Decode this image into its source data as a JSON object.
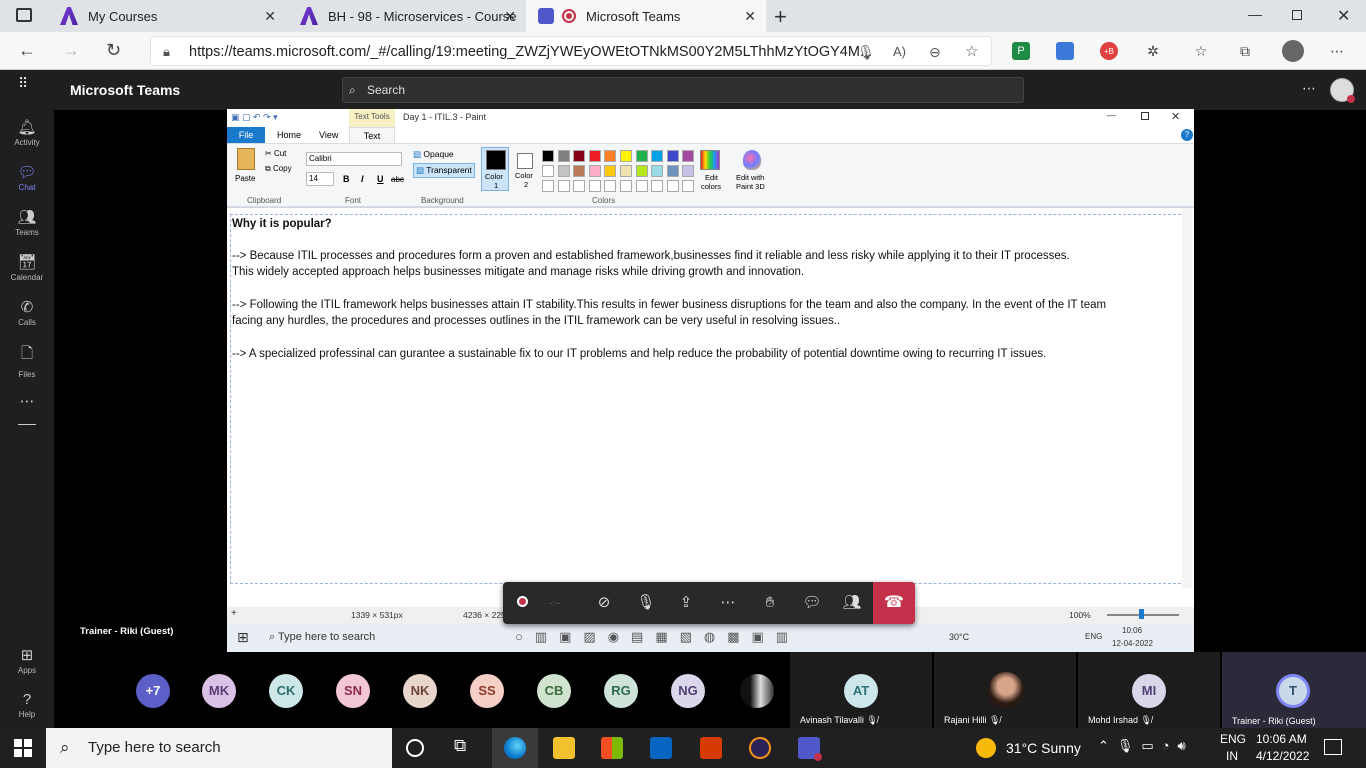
{
  "browser": {
    "tabs": [
      {
        "title": "My Courses"
      },
      {
        "title": "BH - 98 - Microservices - Course"
      },
      {
        "title": "Microsoft Teams"
      }
    ],
    "url": "https://teams.microsoft.com/_#/calling/19:meeting_ZWZjYWEyOWEtOTNkMS00Y2M5LThhMzYtOGY4M..."
  },
  "teams": {
    "app_title": "Microsoft Teams",
    "search_placeholder": "Search",
    "rail": [
      {
        "label": "Activity",
        "icon": "bell-icon"
      },
      {
        "label": "Chat",
        "icon": "chat-icon"
      },
      {
        "label": "Teams",
        "icon": "teams-icon"
      },
      {
        "label": "Calendar",
        "icon": "calendar-icon"
      },
      {
        "label": "Calls",
        "icon": "phone-icon"
      },
      {
        "label": "Files",
        "icon": "file-icon"
      },
      {
        "label": "Apps",
        "icon": "apps-icon"
      },
      {
        "label": "Help",
        "icon": "help-icon"
      }
    ],
    "presenter_label": "Trainer - Riki (Guest)"
  },
  "paint": {
    "title": "Day 1 - ITIL.3 - Paint",
    "context_tab": "Text Tools",
    "tabs": [
      "File",
      "Home",
      "View",
      "Text"
    ],
    "clipboard": {
      "paste": "Paste",
      "cut": "Cut",
      "copy": "Copy",
      "label": "Clipboard"
    },
    "font": {
      "name": "Calibri",
      "size": "14",
      "label": "Font",
      "bold": "B",
      "italic": "I",
      "underline": "U",
      "strike": "abc"
    },
    "background": {
      "opaque": "Opaque",
      "transparent": "Transparent",
      "label": "Background"
    },
    "colors": {
      "color1": "Color\n1",
      "color1_line1": "Color",
      "color1_line2": "1",
      "color2_line1": "Color",
      "color2_line2": "2",
      "label": "Colors",
      "edit_colors_1": "Edit",
      "edit_colors_2": "colors",
      "paint3d_1": "Edit with",
      "paint3d_2": "Paint 3D"
    },
    "palette": [
      "#000000",
      "#7f7f7f",
      "#880015",
      "#ed1c24",
      "#ff7f27",
      "#fff200",
      "#22b14c",
      "#00a2e8",
      "#3f48cc",
      "#a349a4",
      "#ffffff",
      "#c3c3c3",
      "#b97a57",
      "#ffaec9",
      "#ffc90e",
      "#efe4b0",
      "#b5e61d",
      "#99d9ea",
      "#7092be",
      "#c8bfe7"
    ],
    "text_lines": [
      "Why it is popular?",
      "--> Because ITIL processes and procedures form a proven and established framework,businesses find it reliable and less risky while applying it to their IT processes.",
      "This widely accepted approach helps businesses mitigate and manage risks while driving growth and innovation.",
      "--> Following the ITIL framework helps businesses attain IT stability.This results in fewer business disruptions for the team and also the company. In the event of the IT team",
      "facing any hurdles, the procedures and processes outlines in the ITIL framework can be very useful in resolving issues..",
      "--> A specialized professinal can gurantee a sustainable fix to our IT problems and help reduce the probability of potential downtime owing to recurring IT issues."
    ],
    "status": {
      "selection": "1339 × 531px",
      "size": "4236 × 225",
      "zoom": "100%"
    },
    "inner_taskbar": {
      "search": "Type here to search",
      "weather": "30°C",
      "lang": "ENG",
      "time": "10:06",
      "date": "12-04-2022"
    }
  },
  "participants": {
    "overflow": "+7",
    "avatars": [
      {
        "initials": "MK",
        "bg": "#d9c2e6",
        "fg": "#5b3a76"
      },
      {
        "initials": "CK",
        "bg": "#cde6e6",
        "fg": "#2f6f6f"
      },
      {
        "initials": "SN",
        "bg": "#f3c6d3",
        "fg": "#8a2d4a"
      },
      {
        "initials": "NK",
        "bg": "#e8d5cc",
        "fg": "#6d4536"
      },
      {
        "initials": "SS",
        "bg": "#f6d0c7",
        "fg": "#8c3a28"
      },
      {
        "initials": "CB",
        "bg": "#cfe3cf",
        "fg": "#3c6b3c"
      },
      {
        "initials": "RG",
        "bg": "#cfe3d9",
        "fg": "#2e6b4e"
      },
      {
        "initials": "NG",
        "bg": "#dcd6ea",
        "fg": "#4d4177"
      }
    ],
    "tiles": [
      {
        "name": "Avinash Tilavalli",
        "initials": "AT"
      },
      {
        "name": "Rajani Hilli",
        "initials": ""
      },
      {
        "name": "Mohd Irshad",
        "initials": "MI"
      },
      {
        "name": "Trainer - Riki (Guest)",
        "initials": "T"
      }
    ]
  },
  "taskbar": {
    "search": "Type here to search",
    "weather": "31°C  Sunny",
    "lang_top": "ENG",
    "lang_bottom": "IN",
    "time": "10:06 AM",
    "date": "4/12/2022"
  }
}
